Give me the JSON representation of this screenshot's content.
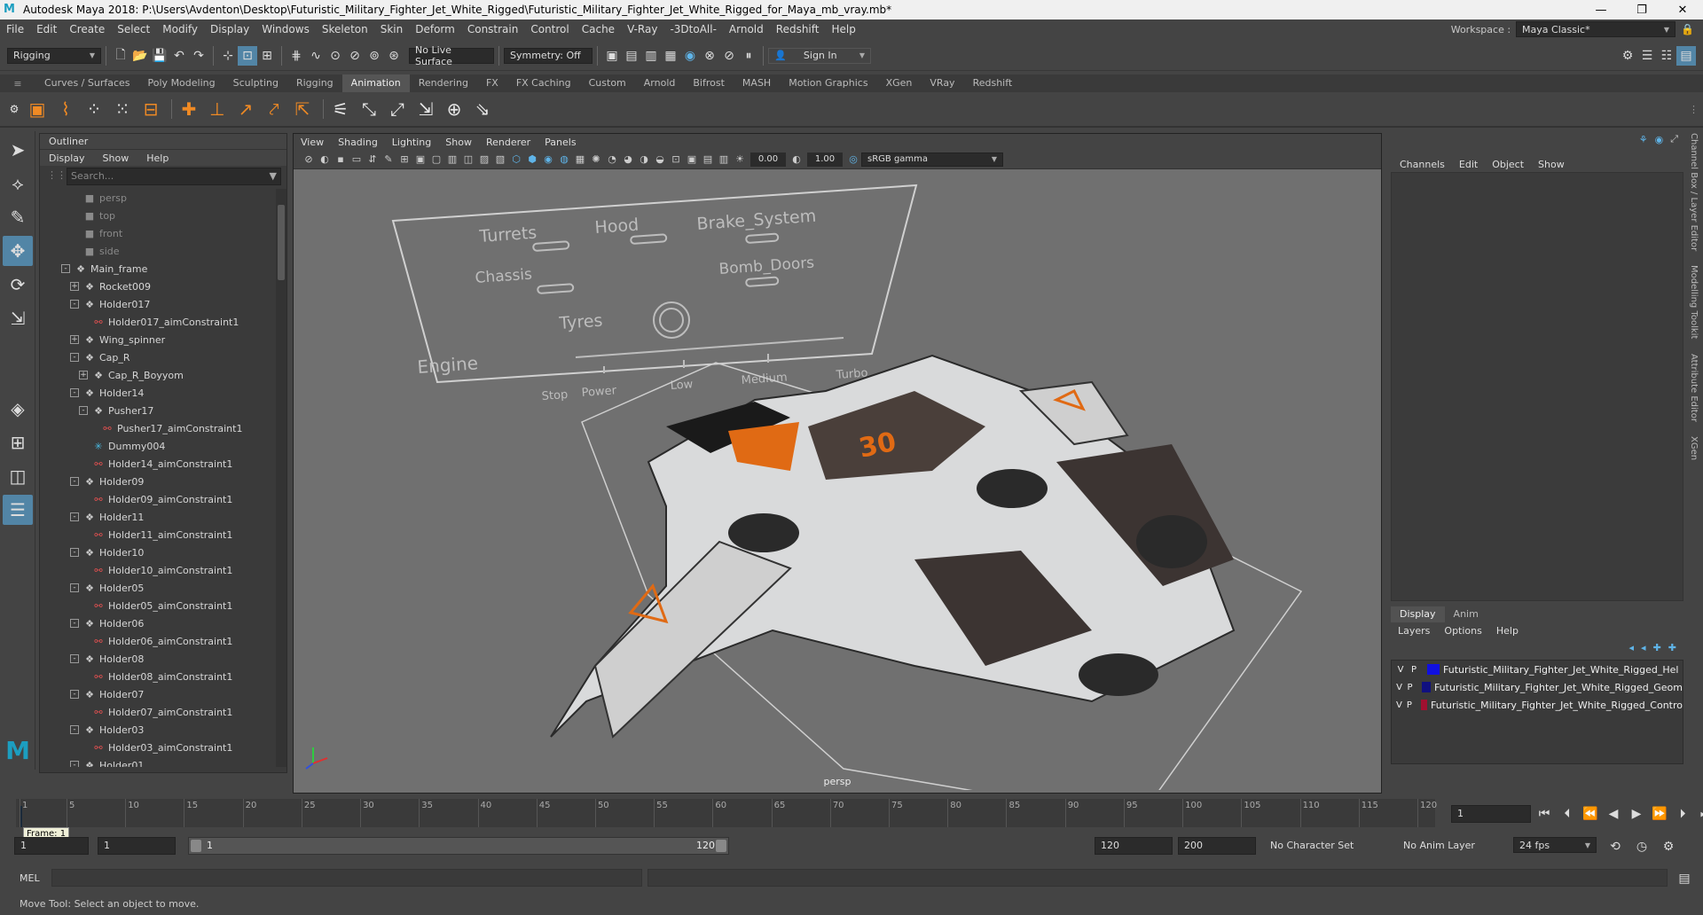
{
  "window": {
    "title": "Autodesk Maya 2018: P:\\Users\\Avdenton\\Desktop\\Futuristic_Military_Fighter_Jet_White_Rigged\\Futuristic_Military_Fighter_Jet_White_Rigged_for_Maya_mb_vray.mb*"
  },
  "menus": [
    "File",
    "Edit",
    "Create",
    "Select",
    "Modify",
    "Display",
    "Windows",
    "Skeleton",
    "Skin",
    "Deform",
    "Constrain",
    "Control",
    "Cache",
    "V-Ray",
    "-3DtoAll-",
    "Arnold",
    "Redshift",
    "Help"
  ],
  "workspace": {
    "label": "Workspace :",
    "value": "Maya Classic*"
  },
  "status": {
    "mode": "Rigging",
    "live_surface": "No Live Surface",
    "symmetry": "Symmetry: Off",
    "sign_in": "Sign In"
  },
  "shelf_tabs": [
    "Curves / Surfaces",
    "Poly Modeling",
    "Sculpting",
    "Rigging",
    "Animation",
    "Rendering",
    "FX",
    "FX Caching",
    "Custom",
    "Arnold",
    "Bifrost",
    "MASH",
    "Motion Graphics",
    "XGen",
    "VRay",
    "Redshift"
  ],
  "shelf_active": "Animation",
  "outliner": {
    "title": "Outliner",
    "menu": [
      "Display",
      "Show",
      "Help"
    ],
    "search_placeholder": "Search...",
    "items": [
      {
        "label": "persp",
        "icon": "camera-icon",
        "indent": 2,
        "kind": "cam"
      },
      {
        "label": "top",
        "icon": "camera-icon",
        "indent": 2,
        "kind": "cam"
      },
      {
        "label": "front",
        "icon": "camera-icon",
        "indent": 2,
        "kind": "cam"
      },
      {
        "label": "side",
        "icon": "camera-icon",
        "indent": 2,
        "kind": "cam"
      },
      {
        "label": "Main_frame",
        "icon": "joint-icon",
        "indent": 1,
        "exp": "-"
      },
      {
        "label": "Rocket009",
        "icon": "joint-icon",
        "indent": 2,
        "exp": "+"
      },
      {
        "label": "Holder017",
        "icon": "joint-icon",
        "indent": 2,
        "exp": "-"
      },
      {
        "label": "Holder017_aimConstraint1",
        "icon": "constraint-icon",
        "indent": 3
      },
      {
        "label": "Wing_spinner",
        "icon": "joint-icon",
        "indent": 2,
        "exp": "+"
      },
      {
        "label": "Cap_R",
        "icon": "joint-icon",
        "indent": 2,
        "exp": "-"
      },
      {
        "label": "Cap_R_Boyyom",
        "icon": "joint-icon",
        "indent": 3,
        "exp": "+"
      },
      {
        "label": "Holder14",
        "icon": "joint-icon",
        "indent": 2,
        "exp": "-"
      },
      {
        "label": "Pusher17",
        "icon": "joint-icon",
        "indent": 3,
        "exp": "-"
      },
      {
        "label": "Pusher17_aimConstraint1",
        "icon": "constraint-icon",
        "indent": 4
      },
      {
        "label": "Dummy004",
        "icon": "locator-icon",
        "indent": 3
      },
      {
        "label": "Holder14_aimConstraint1",
        "icon": "constraint-icon",
        "indent": 3
      },
      {
        "label": "Holder09",
        "icon": "joint-icon",
        "indent": 2,
        "exp": "-"
      },
      {
        "label": "Holder09_aimConstraint1",
        "icon": "constraint-icon",
        "indent": 3
      },
      {
        "label": "Holder11",
        "icon": "joint-icon",
        "indent": 2,
        "exp": "-"
      },
      {
        "label": "Holder11_aimConstraint1",
        "icon": "constraint-icon",
        "indent": 3
      },
      {
        "label": "Holder10",
        "icon": "joint-icon",
        "indent": 2,
        "exp": "-"
      },
      {
        "label": "Holder10_aimConstraint1",
        "icon": "constraint-icon",
        "indent": 3
      },
      {
        "label": "Holder05",
        "icon": "joint-icon",
        "indent": 2,
        "exp": "-"
      },
      {
        "label": "Holder05_aimConstraint1",
        "icon": "constraint-icon",
        "indent": 3
      },
      {
        "label": "Holder06",
        "icon": "joint-icon",
        "indent": 2,
        "exp": "-"
      },
      {
        "label": "Holder06_aimConstraint1",
        "icon": "constraint-icon",
        "indent": 3
      },
      {
        "label": "Holder08",
        "icon": "joint-icon",
        "indent": 2,
        "exp": "-"
      },
      {
        "label": "Holder08_aimConstraint1",
        "icon": "constraint-icon",
        "indent": 3
      },
      {
        "label": "Holder07",
        "icon": "joint-icon",
        "indent": 2,
        "exp": "-"
      },
      {
        "label": "Holder07_aimConstraint1",
        "icon": "constraint-icon",
        "indent": 3
      },
      {
        "label": "Holder03",
        "icon": "joint-icon",
        "indent": 2,
        "exp": "-"
      },
      {
        "label": "Holder03_aimConstraint1",
        "icon": "constraint-icon",
        "indent": 3
      },
      {
        "label": "Holder01",
        "icon": "joint-icon",
        "indent": 2,
        "exp": "-"
      }
    ]
  },
  "viewport": {
    "menu": [
      "View",
      "Shading",
      "Lighting",
      "Show",
      "Renderer",
      "Panels"
    ],
    "exposure": "0.00",
    "gamma": "1.00",
    "color_space": "sRGB gamma",
    "camera": "persp",
    "rig_panel": {
      "labels": [
        "Turrets",
        "Hood",
        "Brake_System",
        "Chassis",
        "Bomb_Doors",
        "Tyres",
        "Engine"
      ],
      "speed": [
        "Stop",
        "Power",
        "Low",
        "Medium",
        "Turbo"
      ]
    }
  },
  "channel_box": {
    "menu": [
      "Channels",
      "Edit",
      "Object",
      "Show"
    ]
  },
  "side_tabs": [
    "Channel Box / Layer Editor",
    "Modelling Toolkit",
    "Attribute Editor",
    "XGen"
  ],
  "layer_editor": {
    "tabs": [
      "Display",
      "Anim"
    ],
    "menu": [
      "Layers",
      "Options",
      "Help"
    ],
    "layers": [
      {
        "v": "V",
        "p": "P",
        "color": "#1010e0",
        "name": "Futuristic_Military_Fighter_Jet_White_Rigged_Hel"
      },
      {
        "v": "V",
        "p": "P",
        "color": "#101080",
        "name": "Futuristic_Military_Fighter_Jet_White_Rigged_Geom"
      },
      {
        "v": "V",
        "p": "P",
        "color": "#a01030",
        "name": "Futuristic_Military_Fighter_Jet_White_Rigged_Contro"
      }
    ]
  },
  "timeline": {
    "ticks": [
      "1",
      "5",
      "10",
      "15",
      "20",
      "25",
      "30",
      "35",
      "40",
      "45",
      "50",
      "55",
      "60",
      "65",
      "70",
      "75",
      "80",
      "85",
      "90",
      "95",
      "100",
      "105",
      "110",
      "115",
      "120"
    ],
    "current_frame": "1",
    "frame_tooltip": "Frame: 1"
  },
  "range": {
    "start": "1",
    "playback_start": "1",
    "slider_start": "1",
    "slider_end": "120",
    "playback_end": "120",
    "end": "200",
    "character_set": "No Character Set",
    "anim_layer": "No Anim Layer",
    "fps": "24 fps"
  },
  "command": {
    "label": "MEL"
  },
  "help_line": "Move Tool: Select an object to move."
}
